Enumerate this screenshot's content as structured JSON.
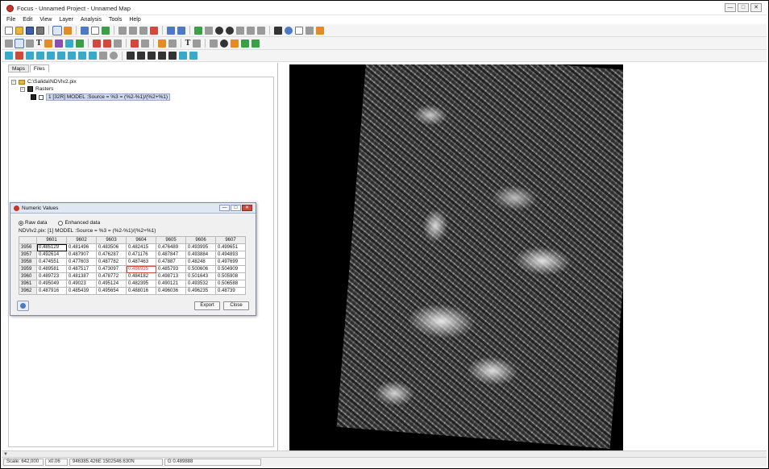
{
  "window": {
    "title": "Focus - Unnamed Project - Unnamed Map",
    "minimize": "—",
    "maximize": "□",
    "close": "✕"
  },
  "menu": [
    "File",
    "Edit",
    "View",
    "Layer",
    "Analysis",
    "Tools",
    "Help"
  ],
  "toolbar": {
    "text_tool_label": "T",
    "text_tool_label_2": "T"
  },
  "left_panel": {
    "tabs": [
      "Maps",
      "Files"
    ],
    "active_tab": "Files",
    "tree": {
      "file": "C:\\Salida\\NDVIv2.pix",
      "group": "Rasters",
      "layer": "1 [32R] MODEL :Source = %3 = (%2-%1)/(%2+%1)"
    }
  },
  "dialog": {
    "title": "Numeric Values",
    "radio_raw": "Raw data",
    "radio_enhanced": "Enhanced data",
    "selected_radio": "Raw data",
    "source_line": "NDVIv2.pix: [1]   MODEL  :Source = %3 = (%2-%1)/(%2+%1)",
    "columns": [
      "9601",
      "9602",
      "9603",
      "9604",
      "9605",
      "9606",
      "9607"
    ],
    "rows": [
      {
        "label": "3956",
        "values": [
          "0.485129",
          "0.481496",
          "0.483506",
          "0.482415",
          "0.476489",
          "0.493995",
          "0.499651"
        ]
      },
      {
        "label": "3957",
        "values": [
          "0.492614",
          "0.487907",
          "0.476287",
          "0.471176",
          "0.487847",
          "0.493884",
          "0.494893"
        ]
      },
      {
        "label": "3958",
        "values": [
          "0.474551",
          "0.477603",
          "0.487782",
          "0.487463",
          "0.47887",
          "0.48248",
          "0.497699"
        ]
      },
      {
        "label": "3959",
        "values": [
          "0.489581",
          "0.487517",
          "0.473097",
          "0.486935",
          "0.485793",
          "0.500606",
          "0.504909"
        ]
      },
      {
        "label": "3960",
        "values": [
          "0.489723",
          "0.481387",
          "0.478772",
          "0.484182",
          "0.498713",
          "0.501643",
          "0.505908"
        ]
      },
      {
        "label": "3961",
        "values": [
          "0.495049",
          "0.49023",
          "0.495124",
          "0.482395",
          "0.490121",
          "0.493532",
          "0.506588"
        ]
      },
      {
        "label": "3962",
        "values": [
          "0.487916",
          "0.485439",
          "0.495654",
          "0.488016",
          "0.496036",
          "0.496235",
          "0.48739"
        ]
      }
    ],
    "export_label": "Export",
    "close_label": "Close"
  },
  "status": {
    "scale": "Scale: 642,000",
    "zoom": "x0.06",
    "coords": "946385.426E 1502546.630N",
    "value": "G 0.489888"
  },
  "colors": {
    "titlebar": "#ffffff",
    "map_background": "#000000",
    "highlight_cell": "#d4473b",
    "dialog_title": "#dfe7f3"
  }
}
